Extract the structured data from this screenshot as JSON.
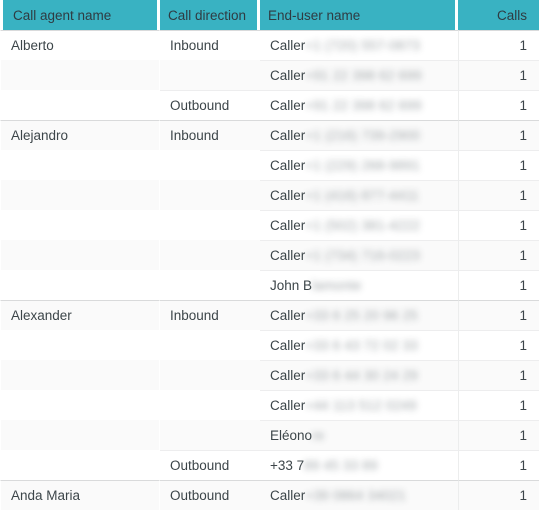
{
  "table": {
    "columns": [
      {
        "key": "agent",
        "label": "Call agent name"
      },
      {
        "key": "direction",
        "label": "Call direction"
      },
      {
        "key": "enduser",
        "label": "End-user name"
      },
      {
        "key": "calls",
        "label": "Calls"
      }
    ],
    "header_background": "#39b2c2",
    "header_text_color": "#2f3b42",
    "stripe_color": "#fafafa",
    "rows": [
      {
        "agent": "Alberto",
        "direction": "Inbound",
        "enduser_prefix": "Caller ",
        "enduser_redacted": "+1 (720) 557-0873",
        "calls": "1",
        "group_start": true,
        "direction_start": true
      },
      {
        "agent": "",
        "direction": "",
        "enduser_prefix": "Caller ",
        "enduser_redacted": "+91 22 398 62 699",
        "calls": "1",
        "group_start": false,
        "direction_start": false
      },
      {
        "agent": "",
        "direction": "Outbound",
        "enduser_prefix": "Caller ",
        "enduser_redacted": "+91 22 398 62 699",
        "calls": "1",
        "group_start": false,
        "direction_start": true
      },
      {
        "agent": "Alejandro",
        "direction": "Inbound",
        "enduser_prefix": "Caller ",
        "enduser_redacted": "+1 (216) 739-2900",
        "calls": "1",
        "group_start": true,
        "direction_start": true
      },
      {
        "agent": "",
        "direction": "",
        "enduser_prefix": "Caller ",
        "enduser_redacted": "+1 (229) 268-9891",
        "calls": "1",
        "group_start": false,
        "direction_start": false
      },
      {
        "agent": "",
        "direction": "",
        "enduser_prefix": "Caller ",
        "enduser_redacted": "+1 (416) 877-4411",
        "calls": "1",
        "group_start": false,
        "direction_start": false
      },
      {
        "agent": "",
        "direction": "",
        "enduser_prefix": "Caller ",
        "enduser_redacted": "+1 (502) 381-4222",
        "calls": "1",
        "group_start": false,
        "direction_start": false
      },
      {
        "agent": "",
        "direction": "",
        "enduser_prefix": "Caller ",
        "enduser_redacted": "+1 (734) 716-0223",
        "calls": "1",
        "group_start": false,
        "direction_start": false
      },
      {
        "agent": "",
        "direction": "",
        "enduser_prefix": "John B",
        "enduser_redacted": "lamonte",
        "calls": "1",
        "group_start": false,
        "direction_start": false
      },
      {
        "agent": "Alexander",
        "direction": "Inbound",
        "enduser_prefix": "Caller ",
        "enduser_redacted": "+33 6 25 20 96 25",
        "calls": "1",
        "group_start": true,
        "direction_start": true
      },
      {
        "agent": "",
        "direction": "",
        "enduser_prefix": "Caller ",
        "enduser_redacted": "+33 6 43 72 02 33",
        "calls": "1",
        "group_start": false,
        "direction_start": false
      },
      {
        "agent": "",
        "direction": "",
        "enduser_prefix": "Caller ",
        "enduser_redacted": "+33 6 44 30 24 29",
        "calls": "1",
        "group_start": false,
        "direction_start": false
      },
      {
        "agent": "",
        "direction": "",
        "enduser_prefix": "Caller ",
        "enduser_redacted": "+44 113 512 0249",
        "calls": "1",
        "group_start": false,
        "direction_start": false
      },
      {
        "agent": "",
        "direction": "",
        "enduser_prefix": "Eléono",
        "enduser_redacted": "re",
        "calls": "1",
        "group_start": false,
        "direction_start": false
      },
      {
        "agent": "",
        "direction": "Outbound",
        "enduser_prefix": "+33 7 ",
        "enduser_redacted": "89 45 33 89",
        "calls": "1",
        "group_start": false,
        "direction_start": true
      },
      {
        "agent": "Anda Maria",
        "direction": "Outbound",
        "enduser_prefix": "Caller ",
        "enduser_redacted": "+39 0864 34021",
        "calls": "1",
        "group_start": true,
        "direction_start": true
      }
    ]
  }
}
